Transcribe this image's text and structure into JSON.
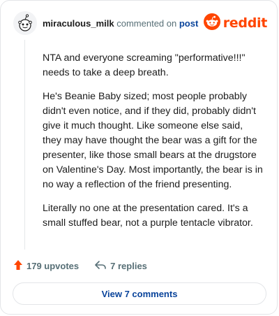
{
  "header": {
    "username": "miraculous_milk",
    "action_text": "commented on",
    "post_link": "post",
    "brand": "reddit",
    "avatar_icon": "snoo-avatar-icon",
    "brand_icon": "reddit-logo-icon"
  },
  "comment": {
    "paragraphs": [
      "NTA and everyone screaming \"performative!!!\" needs to take a deep breath.",
      "He's Beanie Baby sized; most people probably didn't even notice, and if they did, probably didn't give it much thought. Like someone else said, they may have thought the bear was a gift for the presenter, like those small bears at the drugstore on Valentine's Day. Most importantly, the bear is in no way a reflection of the friend presenting.",
      "Literally no one at the presentation cared. It's a small stuffed bear, not a purple tentacle vibrator."
    ]
  },
  "actions": {
    "upvotes": "179 upvotes",
    "replies": "7 replies",
    "upvote_icon": "upvote-arrow-icon",
    "reply_icon": "reply-arrow-icon"
  },
  "footer": {
    "view_comments": "View 7 comments"
  },
  "colors": {
    "brand": "#ff4500",
    "link": "#0a449b",
    "muted": "#576f76"
  }
}
